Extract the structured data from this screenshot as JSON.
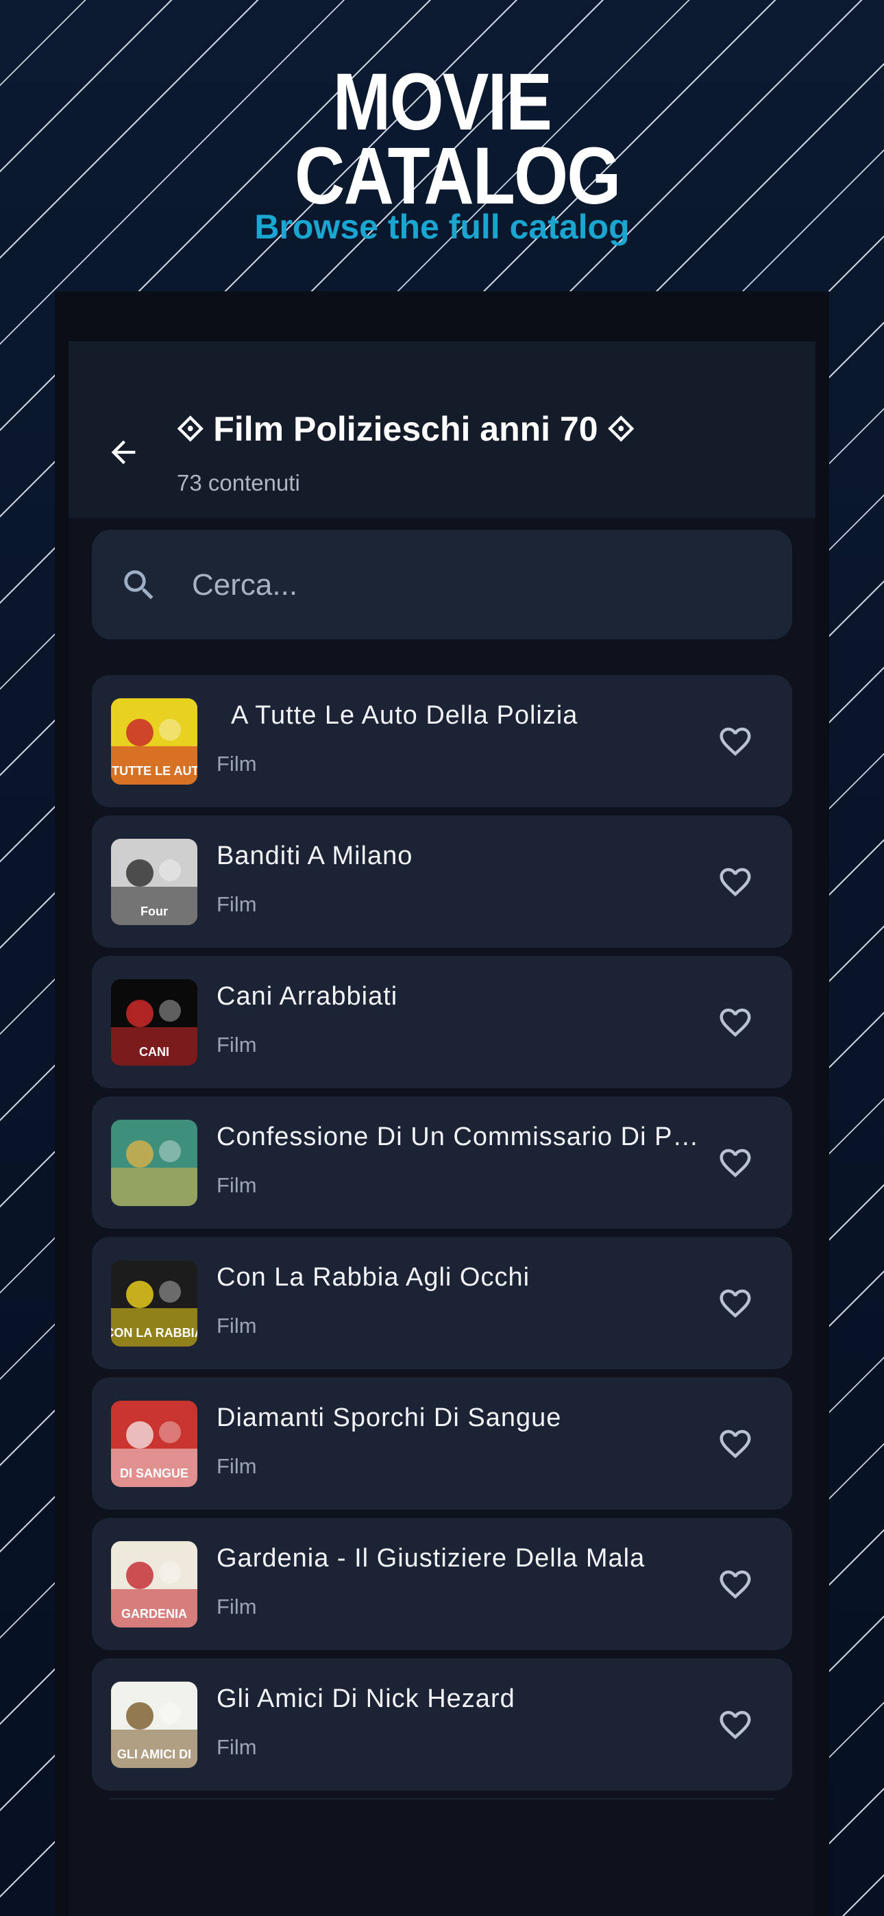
{
  "hero": {
    "title": "MOVIE CATALOG",
    "subtitle": "Browse the full catalog"
  },
  "header": {
    "back_icon": "arrow-left-icon",
    "title": "⟐ Film Polizieschi anni 70 ⟐",
    "count": "73 contenuti"
  },
  "search": {
    "placeholder": "Cerca...",
    "value": "",
    "icon": "search-icon"
  },
  "items": [
    {
      "title": "  A Tutte Le Auto Della Polizia",
      "type": "Film",
      "poster": {
        "bg": "#e9d21f",
        "accent": "#c8222a",
        "text": "A TUTTE LE AUTO"
      }
    },
    {
      "title": "Banditi A Milano",
      "type": "Film",
      "poster": {
        "bg": "#cfcfcf",
        "accent": "#2a2a2a",
        "text": "Four"
      }
    },
    {
      "title": "Cani Arrabbiati",
      "type": "Film",
      "poster": {
        "bg": "#0a0a0a",
        "accent": "#d92a2a",
        "text": "CANI"
      }
    },
    {
      "title": "Confessione Di Un Commissario Di Polizia Al Procuratore Della Repubblica",
      "type": "Film",
      "poster": {
        "bg": "#3f8f7d",
        "accent": "#d9b04a",
        "text": ""
      }
    },
    {
      "title": "Con La Rabbia Agli Occhi",
      "type": "Film",
      "poster": {
        "bg": "#1c1c1c",
        "accent": "#f2d51c",
        "text": "CON LA RABBIA"
      }
    },
    {
      "title": "Diamanti Sporchi Di Sangue",
      "type": "Film",
      "poster": {
        "bg": "#c9342f",
        "accent": "#f3dede",
        "text": "DI SANGUE"
      }
    },
    {
      "title": "Gardenia - Il Giustiziere Della Mala",
      "type": "Film",
      "poster": {
        "bg": "#efe9dc",
        "accent": "#c2272d",
        "text": "GARDENIA"
      }
    },
    {
      "title": "Gli Amici Di Nick Hezard",
      "type": "Film",
      "poster": {
        "bg": "#f1f1ec",
        "accent": "#7a5b2c",
        "text": "GLI AMICI DI"
      }
    }
  ],
  "favorite_icon": "heart-outline-icon",
  "colors": {
    "background": "#0b1a30",
    "accent_subtitle": "#1aa6d0",
    "card": "#1b2334",
    "appbar": "#141b29",
    "heart": "#b9c2d0"
  }
}
